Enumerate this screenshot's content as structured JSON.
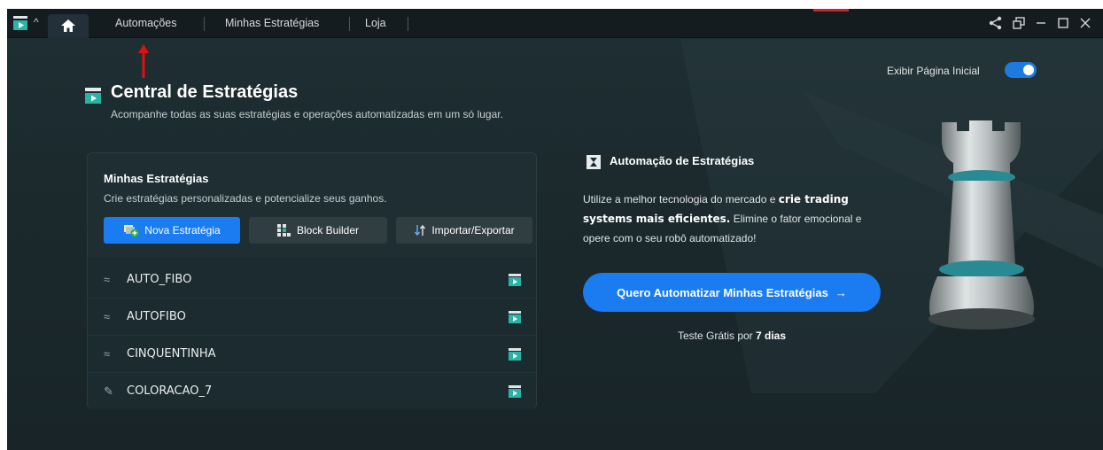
{
  "topbar": {
    "tabs": [
      "Automações",
      "Minhas Estratégias",
      "Loja"
    ],
    "icons": [
      "app-logo-icon",
      "caret-up-icon",
      "home-icon",
      "share-icon",
      "popout-icon",
      "minimize-icon",
      "maximize-icon",
      "close-icon"
    ]
  },
  "header": {
    "title": "Central de Estratégias",
    "subtitle": "Acompanhe todas as suas estratégias e operações automatizadas em um só lugar.",
    "toggle_label": "Exibir Página Inicial",
    "toggle_on": true
  },
  "strategies": {
    "title": "Minhas Estratégias",
    "subtitle": "Crie estratégias personalizadas e potencialize seus ganhos.",
    "buttons": {
      "new": "Nova Estratégia",
      "block": "Block Builder",
      "import": "Importar/Exportar"
    },
    "items": [
      {
        "label": "AUTO_FIBO",
        "icon": "strategy-wave-icon"
      },
      {
        "label": "AUTOFIBO",
        "icon": "strategy-wave-icon"
      },
      {
        "label": "CINQUENTINHA",
        "icon": "strategy-wave-icon"
      },
      {
        "label": "COLORACAO_7",
        "icon": "pin-icon"
      }
    ]
  },
  "automation": {
    "title": "Automação de Estratégias",
    "desc_1": "Utilize a melhor tecnologia do mercado e ",
    "desc_bold": "crie trading systems mais eficientes.",
    "desc_2": " Elimine o fator emocional e opere com o seu robô automatizado!",
    "cta": "Quero Automatizar Minhas Estratégias",
    "trial_prefix": "Teste Grátis por ",
    "trial_bold": "7 dias"
  },
  "colors": {
    "accent": "#1a7cf0",
    "background": "#1b292d",
    "topbar": "#151c1f",
    "annotation_arrow": "#e01010"
  }
}
